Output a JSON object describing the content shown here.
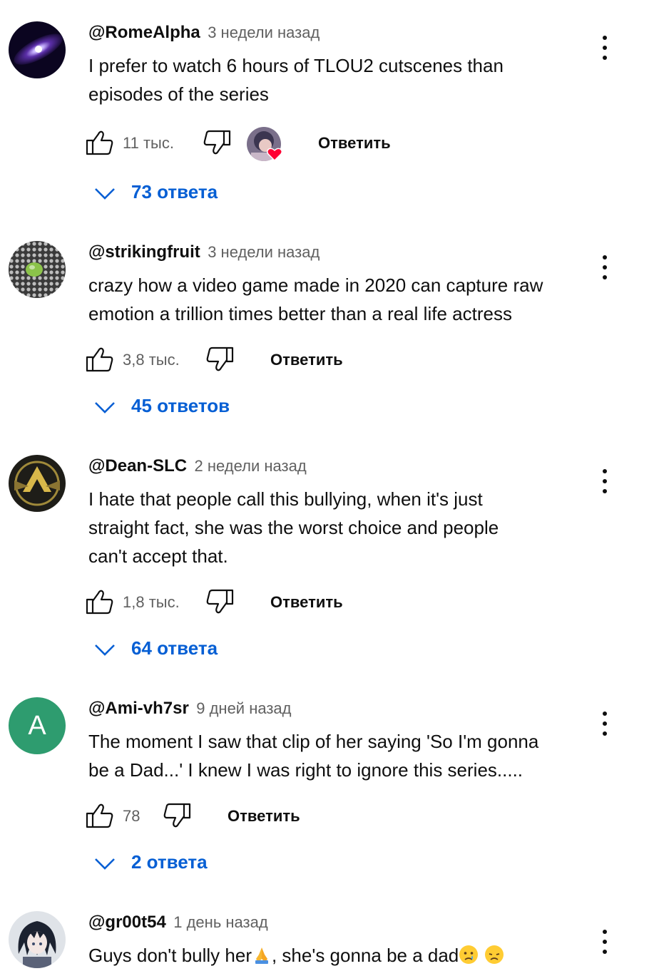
{
  "colors": {
    "link_blue": "#065fd4",
    "secondary_text": "#606060",
    "primary_text": "#0f0f0f",
    "heart_red": "#ff0033"
  },
  "comments": [
    {
      "author": "@RomeAlpha",
      "time": "3 недели назад",
      "text_lines": [
        "I prefer to watch 6 hours of TLOU2 cutscenes than",
        "episodes of the series"
      ],
      "likes": "11 тыс.",
      "reply_label": "Ответить",
      "replies_label": "73 ответа",
      "creator_heart": true
    },
    {
      "author": "@strikingfruit",
      "time": "3 недели назад",
      "text_lines": [
        "crazy how a video game made in 2020 can capture raw",
        "emotion a trillion times better than a real life actress"
      ],
      "likes": "3,8 тыс.",
      "reply_label": "Ответить",
      "replies_label": "45 ответов"
    },
    {
      "author": "@Dean-SLC",
      "time": "2 недели назад",
      "text_lines": [
        "I hate that people call this bullying, when it's just",
        "straight fact, she was the worst choice and people",
        "can't accept that."
      ],
      "likes": "1,8 тыс.",
      "reply_label": "Ответить",
      "replies_label": "64 ответа"
    },
    {
      "author": "@Ami-vh7sr",
      "time": "9 дней назад",
      "text_lines": [
        "The moment I saw that clip of her saying 'So I'm gonna",
        "be a Dad...' I knew I was right to ignore this series....."
      ],
      "likes": "78",
      "reply_label": "Ответить",
      "replies_label": "2 ответа",
      "avatar_letter": "A",
      "avatar_color": "#2e9c6f"
    },
    {
      "author": "@gr00t54",
      "time": "1 день назад",
      "text_parts": [
        "Guys don't bully her",
        ", she's gonna be a dad"
      ],
      "emojis": [
        "folded-hands-icon",
        "crying-face-icon",
        "disappointed-face-icon"
      ]
    }
  ]
}
